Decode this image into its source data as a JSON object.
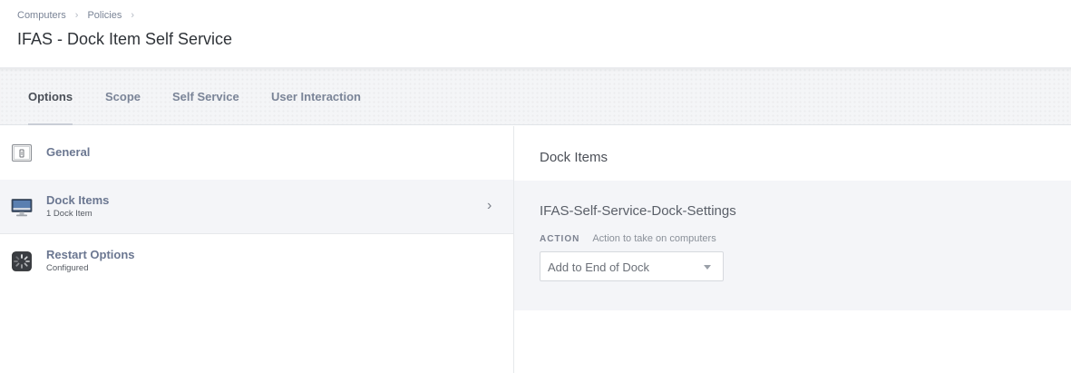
{
  "breadcrumb": {
    "items": [
      "Computers",
      "Policies"
    ],
    "separator": "›"
  },
  "page": {
    "title": "IFAS - Dock Item Self Service"
  },
  "tabs": [
    {
      "label": "Options",
      "active": true
    },
    {
      "label": "Scope",
      "active": false
    },
    {
      "label": "Self Service",
      "active": false
    },
    {
      "label": "User Interaction",
      "active": false
    }
  ],
  "sidebar": {
    "items": [
      {
        "label": "General",
        "subtitle": "",
        "icon": "general-icon",
        "selected": false
      },
      {
        "label": "Dock Items",
        "subtitle": "1 Dock Item",
        "icon": "monitor-icon",
        "selected": true
      },
      {
        "label": "Restart Options",
        "subtitle": "Configured",
        "icon": "restart-icon",
        "selected": false
      }
    ],
    "chevron": "›"
  },
  "content": {
    "heading": "Dock Items",
    "item_title": "IFAS-Self-Service-Dock-Settings",
    "action_label": "ACTION",
    "action_help": "Action to take on computers",
    "action_value": "Add to End of Dock"
  },
  "colors": {
    "tab_text": "#7a8497",
    "sidebar_label": "#6b7791",
    "selected_bg": "#f4f5f8"
  }
}
